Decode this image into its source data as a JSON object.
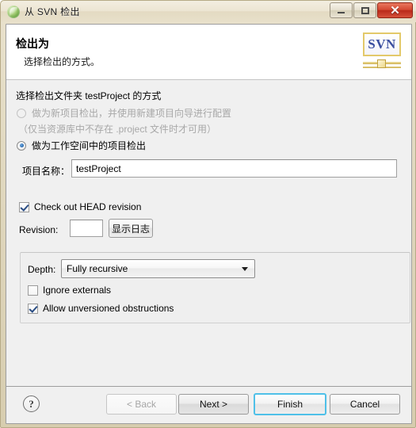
{
  "window": {
    "title": "从 SVN 检出",
    "icon": "eclipse-green-circle-icon",
    "buttons": {
      "minimize": "minimize-icon",
      "maximize": "maximize-icon",
      "close": "✕"
    }
  },
  "header": {
    "title": "检出为",
    "subtitle": "选择检出的方式。",
    "logo_text": "SVN"
  },
  "body": {
    "section_label": "选择检出文件夹 testProject 的方式",
    "options": [
      {
        "label": "做为新项目检出，并使用新建项目向导进行配置",
        "selected": false,
        "enabled": false
      },
      {
        "label": "（仅当资源库中不存在 .project 文件时才可用）",
        "selected": false,
        "enabled": false,
        "is_note": true
      },
      {
        "label": "做为工作空间中的项目检出",
        "selected": true,
        "enabled": true
      }
    ],
    "project_name_label": "项目名称：",
    "project_name_value": "testProject",
    "head_revision_label": "Check out HEAD revision",
    "head_revision_checked": true,
    "revision_label": "Revision:",
    "revision_value": "",
    "show_log_label": "显示日志",
    "depth_label": "Depth:",
    "depth_value": "Fully recursive",
    "depth_options": [
      "Fully recursive"
    ],
    "ignore_externals_label": "Ignore externals",
    "ignore_externals_checked": false,
    "allow_unversioned_label": "Allow unversioned obstructions",
    "allow_unversioned_checked": true
  },
  "footer": {
    "help_label": "?",
    "back_label": "< Back",
    "next_label": "Next >",
    "finish_label": "Finish",
    "cancel_label": "Cancel"
  },
  "colors": {
    "frame": "#ded5bb",
    "dialog_bg": "#f0f0f0",
    "header_bg": "#ffffff",
    "default_button_border": "#4fc0e8",
    "close_button": "#d44a32",
    "radio_accent": "#2b6cb0"
  }
}
